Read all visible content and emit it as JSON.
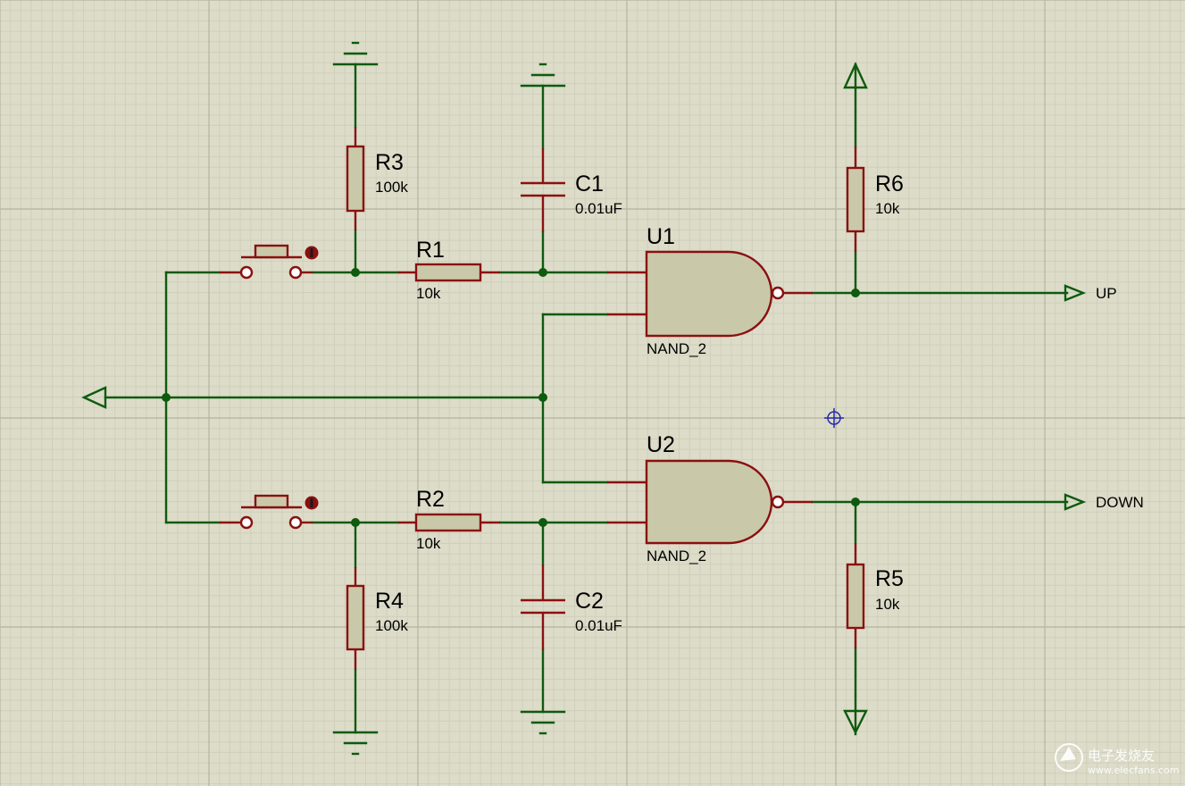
{
  "components": {
    "R1": {
      "ref": "R1",
      "value": "10k"
    },
    "R2": {
      "ref": "R2",
      "value": "10k"
    },
    "R3": {
      "ref": "R3",
      "value": "100k"
    },
    "R4": {
      "ref": "R4",
      "value": "100k"
    },
    "R5": {
      "ref": "R5",
      "value": "10k"
    },
    "R6": {
      "ref": "R6",
      "value": "10k"
    },
    "C1": {
      "ref": "C1",
      "value": "0.01uF"
    },
    "C2": {
      "ref": "C2",
      "value": "0.01uF"
    },
    "U1": {
      "ref": "U1",
      "type": "NAND_2"
    },
    "U2": {
      "ref": "U2",
      "type": "NAND_2"
    }
  },
  "nets": {
    "up": "UP",
    "down": "DOWN"
  },
  "watermark": {
    "title": "电子发烧友",
    "site": "www.elecfans.com"
  },
  "colors": {
    "background": "#dcdcc9",
    "grid_major": "#b9b9a6",
    "grid_minor": "#cfcfbc",
    "wire": "#0e5a0e",
    "pin": "#8a1010",
    "component_body": "#c9c9a9",
    "cursor": "#2a2aa8"
  }
}
